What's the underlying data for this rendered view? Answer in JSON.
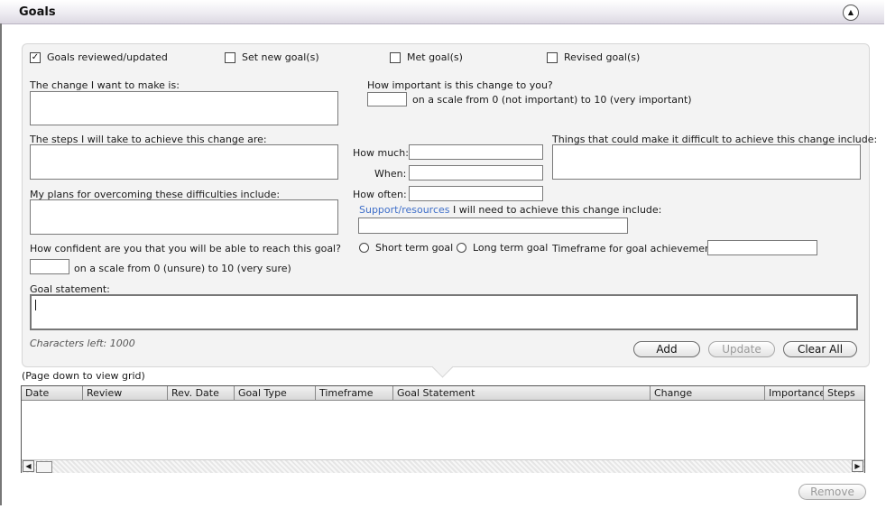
{
  "header": {
    "title": "Goals",
    "collapse_icon": "▲"
  },
  "checkboxes": [
    {
      "label": "Goals reviewed/updated",
      "checked": true
    },
    {
      "label": "Set new goal(s)",
      "checked": false
    },
    {
      "label": "Met goal(s)",
      "checked": false
    },
    {
      "label": "Revised goal(s)",
      "checked": false
    }
  ],
  "form": {
    "change_label": "The change I want to make is:",
    "importance_label": "How important is this change to you?",
    "importance_scale": "on a scale from 0 (not important)  to 10 (very important)",
    "steps_label": "The steps I will take to achieve this change are:",
    "how_much_label": "How much:",
    "when_label": "When:",
    "how_often_label": "How often:",
    "difficulties_label": "Things that could make it difficult to achieve this change include:",
    "plans_label": "My plans for overcoming these difficulties include:",
    "support_link": "Support/resources",
    "support_rest": "I will need to achieve this change include:",
    "confidence_label": "How confident are you that you will be able to reach this goal?",
    "confidence_scale": "on a scale from 0 (unsure)  to 10 (very sure)",
    "short_term_label": "Short term goal",
    "long_term_label": "Long term goal",
    "timeframe_label": "Timeframe for goal achievement:",
    "goal_statement_label": "Goal statement:",
    "chars_left": "Characters left: 1000"
  },
  "buttons": {
    "add": "Add",
    "update": "Update",
    "clear_all": "Clear All",
    "remove": "Remove"
  },
  "grid": {
    "hint": "(Page down to view grid)",
    "columns": [
      "Date",
      "Review",
      "Rev. Date",
      "Goal Type",
      "Timeframe",
      "Goal Statement",
      "Change",
      "Importance",
      "Steps"
    ]
  },
  "icons": {
    "scroll_left": "◀",
    "scroll_right": "▶"
  }
}
